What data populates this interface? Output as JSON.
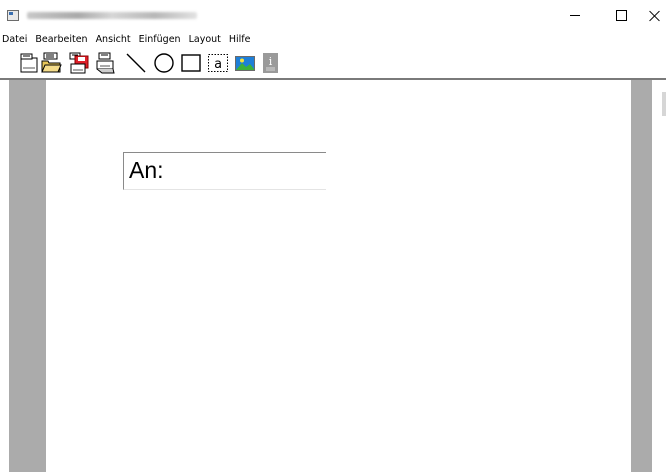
{
  "window": {
    "controls": {
      "minimize": "minimize",
      "maximize": "maximize",
      "close": "close"
    }
  },
  "menu": {
    "items": [
      "Datei",
      "Bearbeiten",
      "Ansicht",
      "Einfügen",
      "Layout",
      "Hilfe"
    ]
  },
  "toolbar": {
    "tools": [
      {
        "name": "new-document-icon"
      },
      {
        "name": "open-folder-icon"
      },
      {
        "name": "save-disk-icon"
      },
      {
        "name": "print-icon"
      },
      {
        "name": "line-tool-icon"
      },
      {
        "name": "ellipse-tool-icon"
      },
      {
        "name": "rectangle-tool-icon"
      },
      {
        "name": "text-tool-icon",
        "glyph": "a"
      },
      {
        "name": "image-tool-icon"
      },
      {
        "name": "info-icon",
        "glyph": "i"
      }
    ]
  },
  "document": {
    "address_label": "An:"
  },
  "colors": {
    "margin_gray": "#ababab",
    "save_red": "#e0202a",
    "image_sky": "#1e7fd8",
    "image_green": "#3bb03b"
  }
}
